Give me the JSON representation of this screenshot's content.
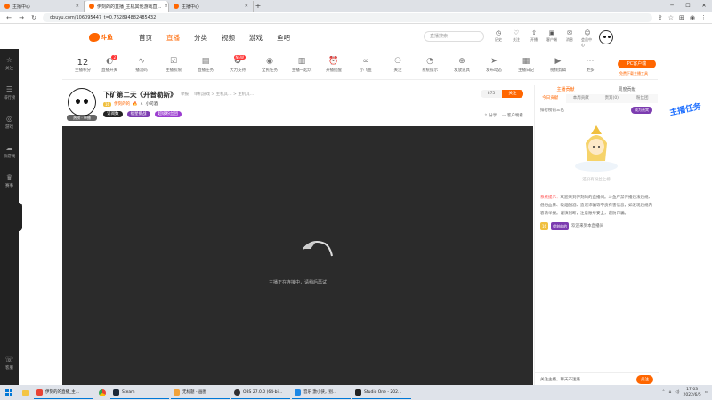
{
  "browser": {
    "tabs": [
      {
        "title": "主播中心",
        "active": false
      },
      {
        "title": "伊刻的的直播_主机其他游戏直…",
        "active": true
      },
      {
        "title": "主播中心",
        "active": false
      }
    ],
    "new_tab": "+",
    "url": "douyu.com/106095447_t=0.762894882485432"
  },
  "site": {
    "logo_text": "斗鱼",
    "nav": [
      "首页",
      "直播",
      "分类",
      "视频",
      "游戏",
      "鱼吧"
    ],
    "nav_active": "直播",
    "search_placeholder": "直播搜索",
    "header_icons": [
      {
        "icon": "clock-icon",
        "label": "历史"
      },
      {
        "icon": "heart-icon",
        "label": "关注"
      },
      {
        "icon": "upload-icon",
        "label": "开播"
      },
      {
        "icon": "sign-icon",
        "label": "客户端"
      },
      {
        "icon": "bell-icon",
        "label": "消息"
      },
      {
        "icon": "user-icon",
        "label": "会员中心"
      }
    ]
  },
  "rail": [
    {
      "icon": "star-icon",
      "label": "关注"
    },
    {
      "icon": "list-icon",
      "label": "排行榜"
    },
    {
      "icon": "game-icon",
      "label": "游戏"
    },
    {
      "icon": "cloud-icon",
      "label": "云游戏"
    },
    {
      "icon": "trophy-icon",
      "label": "赛事"
    }
  ],
  "rail_bottom": {
    "icon": "help-icon",
    "label": "客服"
  },
  "func": {
    "level_num": "12",
    "level_label": "主播积分",
    "buttons": [
      "直播开关",
      "播流码",
      "主播权限",
      "直播任务",
      "大力支持",
      "全民任务",
      "主播一起玩",
      "开播提醒",
      "小飞鱼",
      "关注",
      "系统提示",
      "发放道具",
      "发布动态",
      "主播日记",
      "视频剪辑",
      "更多"
    ],
    "pc_btn": "PC客户端",
    "pc_sub": "免费下载主播工具"
  },
  "room": {
    "title": "下矿第二天《开普勒斯》",
    "report": "举报",
    "breadcrumb": "单机游戏 > 主机其… > 主机其…",
    "level": "16",
    "streamer_name": "伊刻的的",
    "hot": "4",
    "extra": "小司酒",
    "avatar_tag": "热榜 · 单播",
    "badges": [
      "订阅数",
      "福星挑战",
      "超级粉丝团"
    ],
    "follow_count": "875",
    "follow_label": "关注",
    "share": "分享",
    "report2": "客户端看"
  },
  "video": {
    "loading_text": "主播正在连接中，请稍后再试"
  },
  "panel": {
    "rank_tabs": [
      "主播贡献",
      "周度贡献"
    ],
    "period_tabs": [
      "今日贡献",
      "本周贡献",
      "贵宾(0)",
      "粉丝团"
    ],
    "rank_head": "排行榜前三名",
    "rank_btn": "成为贵宾",
    "mascot_text": "还没有粉丝上榜",
    "chat_sys_label": "系统提示：",
    "chat_sys_text": "欢迎来到伊刻的的直播间。斗鱼严禁传播违法违规、低俗血暴、吸烟酗酒、造谣诈骗等不良有害信息，如发现违规内容请举报。谨慎判断，注意账号安全，谨防诈骗。",
    "chat_user_level": "16",
    "chat_user_name": "伊刻的的",
    "chat_user_text": "欢迎来到本直播间",
    "input_placeholder": "关注主播，聊天不迷路",
    "send": "关注"
  },
  "float_widget": "主播任务",
  "taskbar": {
    "apps": [
      "伊刻的的直播_主…",
      "Steam",
      "无标题 - 画图",
      "OBS 27.0.0 (64-bi…",
      "音乐 激小侠，别…",
      "Studio One - 202…"
    ],
    "time": "17:03",
    "date": "2022/6/5"
  },
  "colors": {
    "accent": "#ff6600",
    "purple": "#7c3cb0",
    "rail": "#222222",
    "video_bg": "#2b2b2b"
  }
}
